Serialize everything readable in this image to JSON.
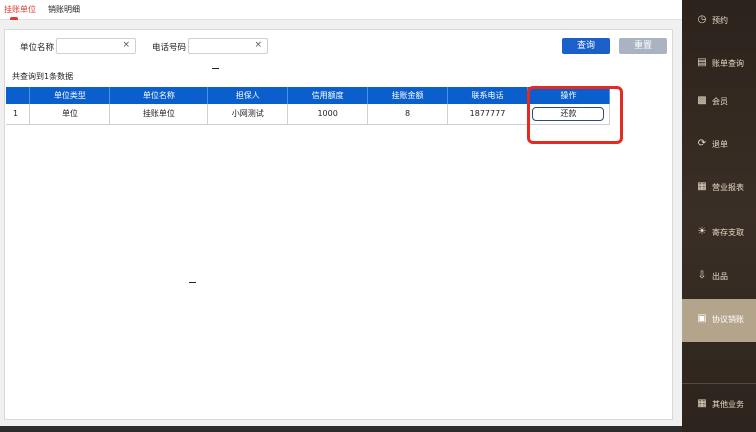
{
  "tabs": [
    {
      "label": "挂账单位",
      "active": true
    },
    {
      "label": "销账明细",
      "active": false
    }
  ],
  "filters": {
    "unit_name_label": "单位名称",
    "unit_name_value": "",
    "phone_label": "电话号码",
    "phone_value": "",
    "clear_symbol": "×"
  },
  "buttons": {
    "query": "查询",
    "reset": "重置"
  },
  "result_count_text": "共查询到1条数据",
  "table": {
    "headers": [
      "",
      "单位类型",
      "单位名称",
      "担保人",
      "信用额度",
      "挂账金额",
      "联系电话",
      "操作"
    ],
    "rows": [
      {
        "index": "1",
        "unit_type": "单位",
        "unit_name": "挂账单位",
        "guarantor": "小网测试",
        "credit_limit": "1000",
        "amount": "8",
        "phone": "1877777",
        "action": "还款"
      }
    ]
  },
  "sidebar": {
    "items": [
      {
        "label": "预约",
        "icon": "calendar-icon"
      },
      {
        "label": "账单查询",
        "icon": "bill-icon"
      },
      {
        "label": "会员",
        "icon": "member-icon"
      },
      {
        "label": "退单",
        "icon": "refund-icon"
      },
      {
        "label": "营业报表",
        "icon": "report-icon"
      },
      {
        "label": "寄存支取",
        "icon": "storage-icon"
      },
      {
        "label": "出品",
        "icon": "dish-icon"
      },
      {
        "label": "协议销账",
        "icon": "agreement-icon",
        "active": true
      },
      {
        "label": "其他业务",
        "icon": "grid-icon"
      }
    ]
  },
  "colors": {
    "accent_red": "#e03a2f",
    "query_blue": "#1b60c8",
    "header_blue": "#0b5fcd",
    "sidebar_active": "#b5a48c"
  }
}
